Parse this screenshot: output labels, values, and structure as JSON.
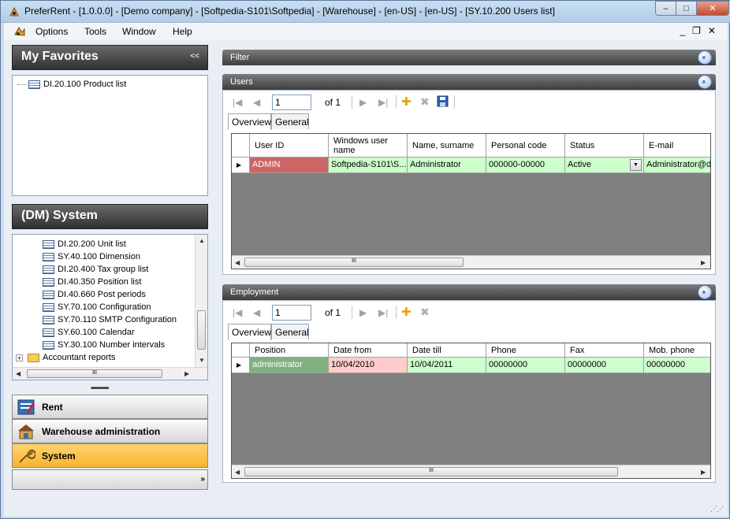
{
  "window": {
    "title": "PreferRent - [1.0.0.0] - [Demo company] - [Softpedia-S101\\Softpedia] - [Warehouse] - [en-US] - [en-US] - [SY.10.200 Users list]",
    "min_label": "–",
    "max_label": "□",
    "close_label": "✕"
  },
  "menu": {
    "items": [
      "Options",
      "Tools",
      "Window",
      "Help"
    ],
    "controls": "_❐✕"
  },
  "favorites": {
    "title": "My Favorites",
    "collapse": "<<",
    "items": [
      {
        "label": "DI.20.100 Product list",
        "icon": "document-list-icon"
      }
    ]
  },
  "system_tree": {
    "title": "(DM) System",
    "items": [
      {
        "label": "DI.20.200 Unit list",
        "icon": "document-list-icon"
      },
      {
        "label": "SY.40.100 Dimension",
        "icon": "document-list-icon"
      },
      {
        "label": "DI.20.400 Tax group list",
        "icon": "document-list-icon"
      },
      {
        "label": "DI.40.350 Position list",
        "icon": "document-list-icon"
      },
      {
        "label": "DI.40.660 Post periods",
        "icon": "document-list-icon"
      },
      {
        "label": "SY.70.100 Configuration",
        "icon": "document-list-icon"
      },
      {
        "label": "SY.70.110 SMTP Configuration",
        "icon": "document-list-icon"
      },
      {
        "label": "SY.60.100 Calendar",
        "icon": "document-list-icon"
      },
      {
        "label": "SY.30.100 Number intervals",
        "icon": "document-list-icon"
      },
      {
        "label": "Accountant reports",
        "icon": "folder-icon"
      }
    ],
    "hscroll_thumb": "III"
  },
  "nav": {
    "splitter": "•••••••••",
    "buttons": [
      {
        "label": "Rent",
        "icon": "rent-icon",
        "color": "#3a6fb8"
      },
      {
        "label": "Warehouse administration",
        "icon": "warehouse-icon",
        "color": "#6a4a2c"
      },
      {
        "label": "System",
        "icon": "wrench-icon",
        "color": "#f7b42c"
      }
    ],
    "more": "»"
  },
  "filter": {
    "title": "Filter",
    "toggle": "»"
  },
  "users": {
    "title": "Users",
    "toggle": "«",
    "page_value": "1",
    "page_of": "of 1",
    "tabs": [
      "Overview",
      "General"
    ],
    "columns": [
      "User ID",
      "Windows user name",
      "Name, surname",
      "Personal code",
      "Status",
      "E-mail"
    ],
    "rows": [
      [
        "ADMIN",
        "Softpedia-S101\\S...",
        "Administrator",
        "000000-00000",
        "Active",
        "Administrator@dc"
      ]
    ],
    "hscroll_thumb": "III"
  },
  "employment": {
    "title": "Employment",
    "toggle": "«",
    "page_value": "1",
    "page_of": "of 1",
    "tabs": [
      "Overview",
      "General"
    ],
    "columns": [
      "Position",
      "Date from",
      "Date till",
      "Phone",
      "Fax",
      "Mob. phone"
    ],
    "rows": [
      [
        "administrator",
        "10/04/2010",
        "10/04/2011",
        "00000000",
        "00000000",
        "00000000"
      ]
    ],
    "hscroll_thumb": "III"
  },
  "toolbar_icons": {
    "first": "|◀",
    "prev": "◀",
    "next": "▶",
    "last": "▶|",
    "add": "✚",
    "delete": "✖",
    "save": "💾"
  },
  "colors": {
    "row_green": "#ccffcc",
    "cell_red": "#cc6666",
    "cell_pink": "#ffcccc",
    "cell_darkgreen": "#7fb27f",
    "accent_yellow": "#f7b42c"
  }
}
